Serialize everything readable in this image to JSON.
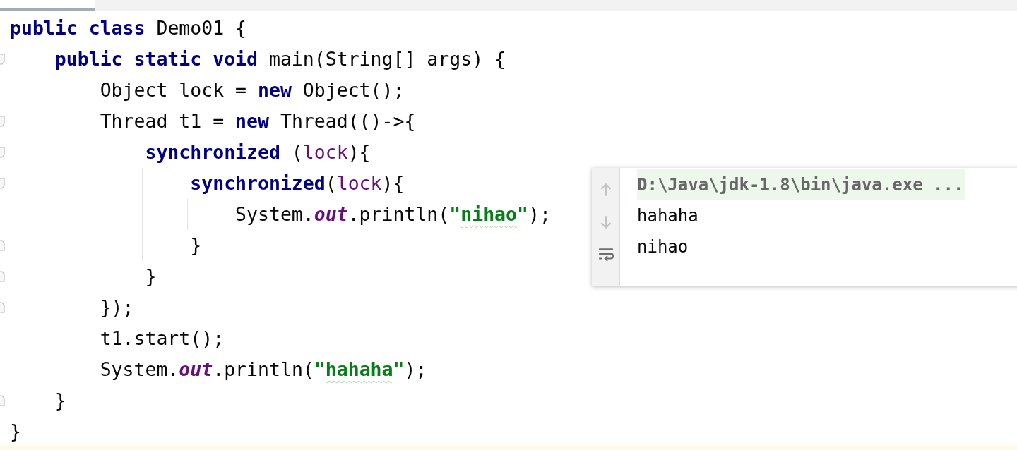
{
  "editor_tab": {
    "selected": true
  },
  "code_lines": [
    {
      "fold_start": false,
      "fold_end": false,
      "tokens": [
        {
          "t": "public class ",
          "kind": "keyword"
        },
        {
          "t": "Demo01 {",
          "kind": "plain"
        }
      ]
    },
    {
      "fold_start": true,
      "fold_end": false,
      "tokens": [
        {
          "t": "    public static void ",
          "kind": "keyword"
        },
        {
          "t": "main(String[] args) {",
          "kind": "plain"
        }
      ]
    },
    {
      "fold_start": false,
      "fold_end": false,
      "tokens": [
        {
          "t": "        Object lock = ",
          "kind": "plain"
        },
        {
          "t": "new ",
          "kind": "keyword"
        },
        {
          "t": "Object();",
          "kind": "plain"
        }
      ]
    },
    {
      "fold_start": true,
      "fold_end": false,
      "tokens": [
        {
          "t": "        Thread t1 = ",
          "kind": "plain"
        },
        {
          "t": "new ",
          "kind": "keyword"
        },
        {
          "t": "Thread(()->{",
          "kind": "plain"
        }
      ]
    },
    {
      "fold_start": true,
      "fold_end": false,
      "tokens": [
        {
          "t": "            synchronized ",
          "kind": "keyword"
        },
        {
          "t": "(",
          "kind": "plain"
        },
        {
          "t": "lock",
          "kind": "variable"
        },
        {
          "t": "){",
          "kind": "plain"
        }
      ]
    },
    {
      "fold_start": true,
      "fold_end": false,
      "tokens": [
        {
          "t": "                synchronized",
          "kind": "keyword"
        },
        {
          "t": "(",
          "kind": "plain"
        },
        {
          "t": "lock",
          "kind": "variable"
        },
        {
          "t": "){",
          "kind": "plain"
        }
      ]
    },
    {
      "fold_start": false,
      "fold_end": false,
      "tokens": [
        {
          "t": "                    System.",
          "kind": "plain"
        },
        {
          "t": "out",
          "kind": "field"
        },
        {
          "t": ".println(",
          "kind": "plain"
        },
        {
          "t": "\"",
          "kind": "string"
        },
        {
          "t": "nihao",
          "kind": "typo"
        },
        {
          "t": "\"",
          "kind": "string"
        },
        {
          "t": ");",
          "kind": "plain"
        }
      ]
    },
    {
      "fold_start": false,
      "fold_end": true,
      "tokens": [
        {
          "t": "                }",
          "kind": "plain"
        }
      ]
    },
    {
      "fold_start": false,
      "fold_end": true,
      "tokens": [
        {
          "t": "            }",
          "kind": "plain"
        }
      ]
    },
    {
      "fold_start": false,
      "fold_end": true,
      "tokens": [
        {
          "t": "        });",
          "kind": "plain"
        }
      ]
    },
    {
      "fold_start": false,
      "fold_end": false,
      "tokens": [
        {
          "t": "        t1.start();",
          "kind": "plain"
        }
      ]
    },
    {
      "fold_start": false,
      "fold_end": false,
      "tokens": [
        {
          "t": "        System.",
          "kind": "plain"
        },
        {
          "t": "out",
          "kind": "field"
        },
        {
          "t": ".println(",
          "kind": "plain"
        },
        {
          "t": "\"",
          "kind": "string"
        },
        {
          "t": "hahaha",
          "kind": "typo"
        },
        {
          "t": "\"",
          "kind": "string"
        },
        {
          "t": ");",
          "kind": "plain"
        }
      ]
    },
    {
      "fold_start": false,
      "fold_end": true,
      "tokens": [
        {
          "t": "    }",
          "kind": "plain"
        }
      ]
    },
    {
      "fold_start": false,
      "fold_end": false,
      "tokens": [
        {
          "t": "}",
          "kind": "plain"
        }
      ]
    }
  ],
  "console": {
    "lines": [
      {
        "text": "D:\\Java\\jdk-1.8\\bin\\java.exe ...",
        "kind": "command"
      },
      {
        "text": "hahaha",
        "kind": "output"
      },
      {
        "text": "nihao",
        "kind": "output"
      }
    ]
  }
}
